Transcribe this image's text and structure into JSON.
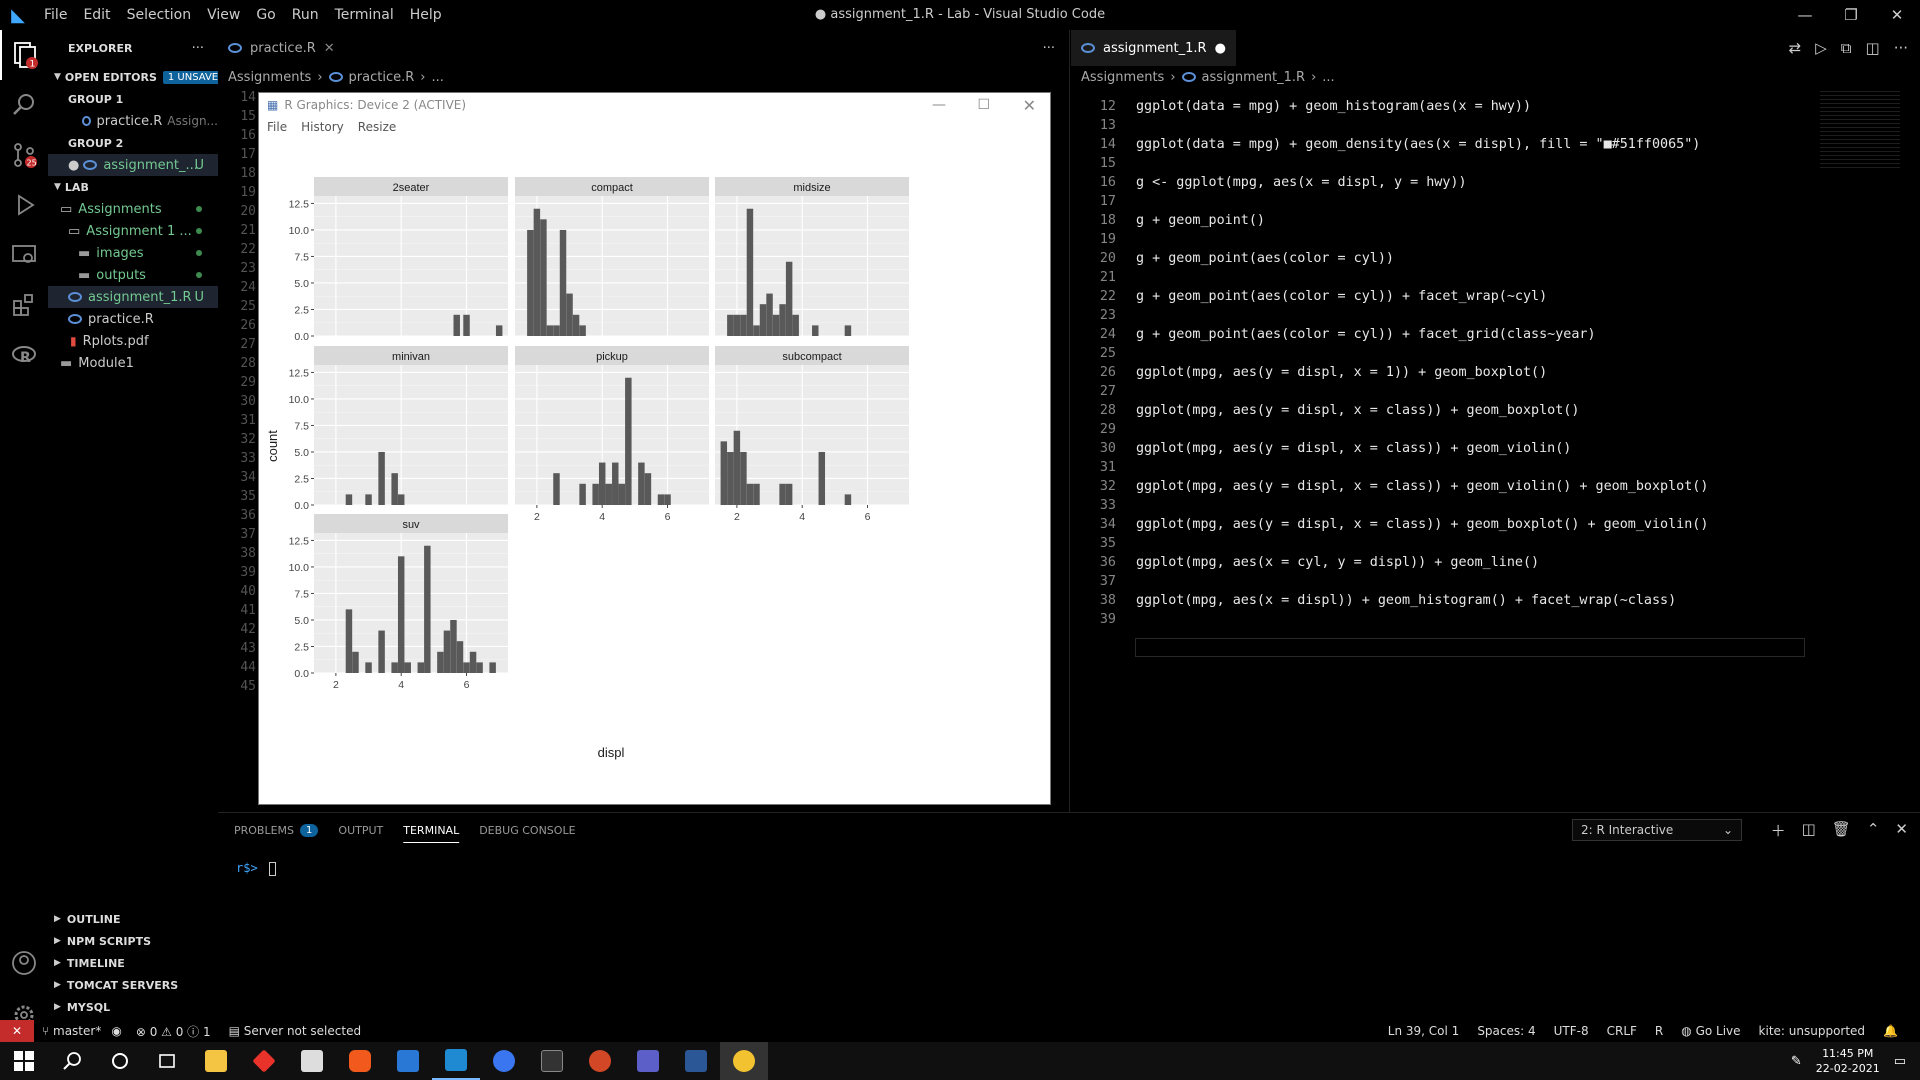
{
  "titlebar": {
    "menu": [
      "File",
      "Edit",
      "Selection",
      "View",
      "Go",
      "Run",
      "Terminal",
      "Help"
    ],
    "title": "● assignment_1.R - Lab - Visual Studio Code"
  },
  "sidebar": {
    "explorer": "EXPLORER",
    "open_editors": "OPEN EDITORS",
    "unsaved": "1 UNSAVED",
    "group1": "GROUP 1",
    "practice_file": "practice.R",
    "practice_hint": "Assign...",
    "group2": "GROUP 2",
    "assignment_file": "assignment_...",
    "modified_flag": "U",
    "lab": "LAB",
    "assignments": "Assignments",
    "assignment1": "Assignment 1 ...",
    "images": "images",
    "outputs": "outputs",
    "assignment_r": "assignment_1.R",
    "practice_r": "practice.R",
    "rplots": "Rplots.pdf",
    "module1": "Module1",
    "outline": "OUTLINE",
    "npm": "NPM SCRIPTS",
    "timeline": "TIMELINE",
    "tomcat": "TOMCAT SERVERS",
    "mysql": "MYSQL"
  },
  "left_editor": {
    "tab": "practice.R",
    "crumbs": [
      "Assignments",
      "practice.R",
      "..."
    ],
    "line_numbers": [
      "14",
      "15",
      "16",
      "17",
      "18",
      "19",
      "20",
      "21",
      "22",
      "23",
      "24",
      "25",
      "26",
      "27",
      "28",
      "29",
      "30",
      "31",
      "32",
      "33",
      "34",
      "35",
      "36",
      "37",
      "38",
      "39",
      "40",
      "41",
      "42",
      "43",
      "44",
      "45"
    ]
  },
  "right_editor": {
    "tab": "assignment_1.R",
    "crumbs": [
      "Assignments",
      "assignment_1.R",
      "..."
    ],
    "lines": [
      {
        "n": "12",
        "code": "ggplot(data = mpg) + geom_histogram(aes(x = hwy))"
      },
      {
        "n": "13",
        "code": ""
      },
      {
        "n": "14",
        "code": "ggplot(data = mpg) + geom_density(aes(x = displ), fill = \"■#51ff0065\")"
      },
      {
        "n": "15",
        "code": ""
      },
      {
        "n": "16",
        "code": "g <- ggplot(mpg, aes(x = displ, y = hwy))"
      },
      {
        "n": "17",
        "code": ""
      },
      {
        "n": "18",
        "code": "g + geom_point()"
      },
      {
        "n": "19",
        "code": ""
      },
      {
        "n": "20",
        "code": "g + geom_point(aes(color = cyl))"
      },
      {
        "n": "21",
        "code": ""
      },
      {
        "n": "22",
        "code": "g + geom_point(aes(color = cyl)) + facet_wrap(~cyl)"
      },
      {
        "n": "23",
        "code": ""
      },
      {
        "n": "24",
        "code": "g + geom_point(aes(color = cyl)) + facet_grid(class~year)"
      },
      {
        "n": "25",
        "code": ""
      },
      {
        "n": "26",
        "code": "ggplot(mpg, aes(y = displ, x = 1)) + geom_boxplot()"
      },
      {
        "n": "27",
        "code": ""
      },
      {
        "n": "28",
        "code": "ggplot(mpg, aes(y = displ, x = class)) + geom_boxplot()"
      },
      {
        "n": "29",
        "code": ""
      },
      {
        "n": "30",
        "code": "ggplot(mpg, aes(y = displ, x = class)) + geom_violin()"
      },
      {
        "n": "31",
        "code": ""
      },
      {
        "n": "32",
        "code": "ggplot(mpg, aes(y = displ, x = class)) + geom_violin() + geom_boxplot()"
      },
      {
        "n": "33",
        "code": ""
      },
      {
        "n": "34",
        "code": "ggplot(mpg, aes(y = displ, x = class)) + geom_boxplot() + geom_violin()"
      },
      {
        "n": "35",
        "code": ""
      },
      {
        "n": "36",
        "code": "ggplot(mpg, aes(x = cyl, y = displ)) + geom_line()"
      },
      {
        "n": "37",
        "code": ""
      },
      {
        "n": "38",
        "code": "ggplot(mpg, aes(x = displ)) + geom_histogram() + facet_wrap(~class)"
      },
      {
        "n": "39",
        "code": ""
      }
    ]
  },
  "rgraphics": {
    "title": "R Graphics: Device 2 (ACTIVE)",
    "menu": [
      "File",
      "History",
      "Resize"
    ]
  },
  "panel": {
    "tabs": [
      "PROBLEMS",
      "OUTPUT",
      "TERMINAL",
      "DEBUG CONSOLE"
    ],
    "problems_count": "1",
    "terminal_select": "2: R Interactive",
    "prompt": "r$>"
  },
  "statusbar": {
    "branch": "master*",
    "problems": "⊗ 0 ⚠ 0 ⓘ 1",
    "server": "Server not selected",
    "position": "Ln 39, Col 1",
    "spaces": "Spaces: 4",
    "encoding": "UTF-8",
    "eol": "CRLF",
    "lang": "R",
    "golive": "Go Live",
    "kite": "kite: unsupported"
  },
  "taskbar": {
    "time": "11:45 PM",
    "date": "22-02-2021"
  },
  "colors": {
    "accent": "#3fa7ff",
    "bar": "#595959",
    "panel_bg": "#ebebeb",
    "strip": "#d9d9d9"
  },
  "chart_data": {
    "type": "bar",
    "xlabel": "displ",
    "ylabel": "count",
    "y_ticks": [
      "0.0",
      "2.5",
      "5.0",
      "7.5",
      "10.0",
      "12.5"
    ],
    "ylim": [
      0,
      13.2
    ],
    "x_ticks": [
      "2",
      "4",
      "6"
    ],
    "xlim": [
      1.33,
      7.27
    ],
    "binwidth": 0.198,
    "facets": [
      {
        "name": "2seater",
        "bins": [
          [
            5.7,
            2
          ],
          [
            6.0,
            2
          ],
          [
            7.0,
            1
          ]
        ]
      },
      {
        "name": "compact",
        "bins": [
          [
            1.8,
            10
          ],
          [
            2.0,
            12
          ],
          [
            2.2,
            11
          ],
          [
            2.4,
            1
          ],
          [
            2.6,
            1
          ],
          [
            2.8,
            10
          ],
          [
            3.0,
            4
          ],
          [
            3.2,
            2
          ],
          [
            3.4,
            1
          ]
        ]
      },
      {
        "name": "midsize",
        "bins": [
          [
            1.8,
            2
          ],
          [
            2.0,
            2
          ],
          [
            2.2,
            2
          ],
          [
            2.4,
            12
          ],
          [
            2.6,
            1
          ],
          [
            2.8,
            3
          ],
          [
            3.0,
            4
          ],
          [
            3.2,
            2
          ],
          [
            3.4,
            3
          ],
          [
            3.6,
            7
          ],
          [
            3.8,
            2
          ],
          [
            4.4,
            1
          ],
          [
            5.4,
            1
          ]
        ]
      },
      {
        "name": "minivan",
        "bins": [
          [
            2.4,
            1
          ],
          [
            3.0,
            1
          ],
          [
            3.4,
            5
          ],
          [
            3.8,
            3
          ],
          [
            4.0,
            1
          ]
        ]
      },
      {
        "name": "pickup",
        "bins": [
          [
            2.6,
            3
          ],
          [
            3.4,
            2
          ],
          [
            3.8,
            2
          ],
          [
            4.0,
            4
          ],
          [
            4.2,
            2
          ],
          [
            4.4,
            4
          ],
          [
            4.6,
            2
          ],
          [
            4.8,
            12
          ],
          [
            5.2,
            4
          ],
          [
            5.4,
            3
          ],
          [
            5.8,
            1
          ],
          [
            6.0,
            1
          ]
        ]
      },
      {
        "name": "subcompact",
        "bins": [
          [
            1.6,
            6
          ],
          [
            1.8,
            5
          ],
          [
            2.0,
            7
          ],
          [
            2.2,
            5
          ],
          [
            2.4,
            2
          ],
          [
            2.6,
            2
          ],
          [
            3.4,
            2
          ],
          [
            3.6,
            2
          ],
          [
            4.6,
            5
          ],
          [
            5.4,
            1
          ]
        ]
      },
      {
        "name": "suv",
        "bins": [
          [
            2.4,
            6
          ],
          [
            2.6,
            2
          ],
          [
            3.0,
            1
          ],
          [
            3.4,
            4
          ],
          [
            3.8,
            1
          ],
          [
            4.0,
            11
          ],
          [
            4.2,
            1
          ],
          [
            4.6,
            1
          ],
          [
            4.8,
            12
          ],
          [
            5.2,
            2
          ],
          [
            5.4,
            4
          ],
          [
            5.6,
            5
          ],
          [
            5.8,
            3
          ],
          [
            6.0,
            1
          ],
          [
            6.2,
            2
          ],
          [
            6.4,
            1
          ],
          [
            6.8,
            1
          ]
        ]
      }
    ]
  }
}
